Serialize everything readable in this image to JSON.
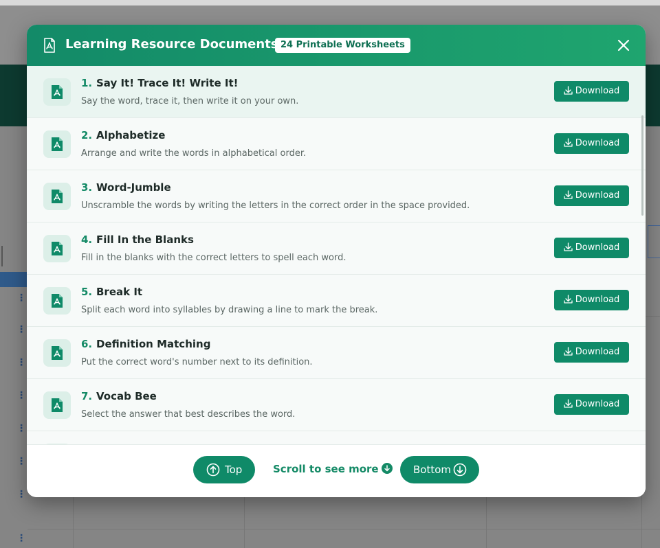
{
  "modal": {
    "title": "Learning Resource Documents",
    "badge": "24 Printable Worksheets"
  },
  "worksheets": [
    {
      "number": "1.",
      "title": "Say It! Trace It! Write It!",
      "description": "Say the word, trace it, then write it on your own.",
      "action": "Download"
    },
    {
      "number": "2.",
      "title": "Alphabetize",
      "description": "Arrange and write the words in alphabetical order.",
      "action": "Download"
    },
    {
      "number": "3.",
      "title": "Word-Jumble",
      "description": "Unscramble the words by writing the letters in the correct order in the space provided.",
      "action": "Download"
    },
    {
      "number": "4.",
      "title": "Fill In the Blanks",
      "description": "Fill in the blanks with the correct letters to spell each word.",
      "action": "Download"
    },
    {
      "number": "5.",
      "title": "Break It",
      "description": "Split each word into syllables by drawing a line to mark the break.",
      "action": "Download"
    },
    {
      "number": "6.",
      "title": "Definition Matching",
      "description": "Put the correct word's number next to its definition.",
      "action": "Download"
    },
    {
      "number": "7.",
      "title": "Vocab Bee",
      "description": "Select the answer that best describes the word.",
      "action": "Download"
    }
  ],
  "footer": {
    "top_label": "Top",
    "hint": "Scroll to see more",
    "bottom_label": "Bottom"
  },
  "colors": {
    "primary": "#0f8a68",
    "header_gradient_start": "#138a68",
    "header_gradient_end": "#1fa56f"
  },
  "icons": {
    "header": "pdf-file-icon",
    "item": "pdf-file-icon",
    "close": "close-icon",
    "download": "download-icon",
    "top": "arrow-up-circle-icon",
    "bottom": "arrow-down-circle-icon"
  }
}
